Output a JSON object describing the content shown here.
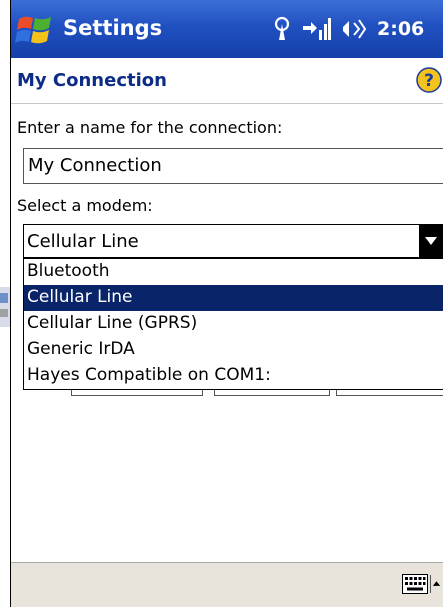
{
  "titlebar": {
    "app_title": "Settings",
    "clock": "2:06",
    "icons": [
      "windows-start-icon",
      "antenna-icon",
      "connectivity-icon",
      "speaker-icon"
    ]
  },
  "header": {
    "title": "My Connection",
    "help_icon": "help-icon"
  },
  "form": {
    "name_label": "Enter a name for the connection:",
    "name_value": "My Connection",
    "modem_label": "Select a modem:",
    "modem_selected": "Cellular Line",
    "modem_options": [
      "Bluetooth",
      "Cellular Line",
      "Cellular Line (GPRS)",
      "Generic IrDA",
      "Hayes Compatible on COM1:"
    ]
  },
  "bottombar": {
    "keyboard_icon": "keyboard-icon",
    "sip_icon": "sip-up-arrow-icon"
  },
  "colors": {
    "title_blue": "#2050c0",
    "header_text": "#0c2c88",
    "selection": "#0a246a"
  }
}
